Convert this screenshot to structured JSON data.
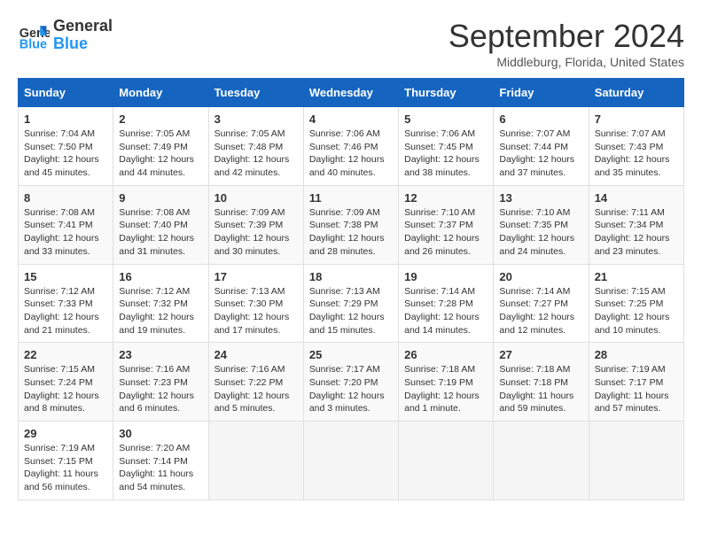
{
  "header": {
    "logo_line1": "General",
    "logo_line2": "Blue",
    "month": "September 2024",
    "location": "Middleburg, Florida, United States"
  },
  "days_of_week": [
    "Sunday",
    "Monday",
    "Tuesday",
    "Wednesday",
    "Thursday",
    "Friday",
    "Saturday"
  ],
  "weeks": [
    [
      {
        "day": "1",
        "sunrise": "7:04 AM",
        "sunset": "7:50 PM",
        "daylight": "12 hours and 45 minutes."
      },
      {
        "day": "2",
        "sunrise": "7:05 AM",
        "sunset": "7:49 PM",
        "daylight": "12 hours and 44 minutes."
      },
      {
        "day": "3",
        "sunrise": "7:05 AM",
        "sunset": "7:48 PM",
        "daylight": "12 hours and 42 minutes."
      },
      {
        "day": "4",
        "sunrise": "7:06 AM",
        "sunset": "7:46 PM",
        "daylight": "12 hours and 40 minutes."
      },
      {
        "day": "5",
        "sunrise": "7:06 AM",
        "sunset": "7:45 PM",
        "daylight": "12 hours and 38 minutes."
      },
      {
        "day": "6",
        "sunrise": "7:07 AM",
        "sunset": "7:44 PM",
        "daylight": "12 hours and 37 minutes."
      },
      {
        "day": "7",
        "sunrise": "7:07 AM",
        "sunset": "7:43 PM",
        "daylight": "12 hours and 35 minutes."
      }
    ],
    [
      {
        "day": "8",
        "sunrise": "7:08 AM",
        "sunset": "7:41 PM",
        "daylight": "12 hours and 33 minutes."
      },
      {
        "day": "9",
        "sunrise": "7:08 AM",
        "sunset": "7:40 PM",
        "daylight": "12 hours and 31 minutes."
      },
      {
        "day": "10",
        "sunrise": "7:09 AM",
        "sunset": "7:39 PM",
        "daylight": "12 hours and 30 minutes."
      },
      {
        "day": "11",
        "sunrise": "7:09 AM",
        "sunset": "7:38 PM",
        "daylight": "12 hours and 28 minutes."
      },
      {
        "day": "12",
        "sunrise": "7:10 AM",
        "sunset": "7:37 PM",
        "daylight": "12 hours and 26 minutes."
      },
      {
        "day": "13",
        "sunrise": "7:10 AM",
        "sunset": "7:35 PM",
        "daylight": "12 hours and 24 minutes."
      },
      {
        "day": "14",
        "sunrise": "7:11 AM",
        "sunset": "7:34 PM",
        "daylight": "12 hours and 23 minutes."
      }
    ],
    [
      {
        "day": "15",
        "sunrise": "7:12 AM",
        "sunset": "7:33 PM",
        "daylight": "12 hours and 21 minutes."
      },
      {
        "day": "16",
        "sunrise": "7:12 AM",
        "sunset": "7:32 PM",
        "daylight": "12 hours and 19 minutes."
      },
      {
        "day": "17",
        "sunrise": "7:13 AM",
        "sunset": "7:30 PM",
        "daylight": "12 hours and 17 minutes."
      },
      {
        "day": "18",
        "sunrise": "7:13 AM",
        "sunset": "7:29 PM",
        "daylight": "12 hours and 15 minutes."
      },
      {
        "day": "19",
        "sunrise": "7:14 AM",
        "sunset": "7:28 PM",
        "daylight": "12 hours and 14 minutes."
      },
      {
        "day": "20",
        "sunrise": "7:14 AM",
        "sunset": "7:27 PM",
        "daylight": "12 hours and 12 minutes."
      },
      {
        "day": "21",
        "sunrise": "7:15 AM",
        "sunset": "7:25 PM",
        "daylight": "12 hours and 10 minutes."
      }
    ],
    [
      {
        "day": "22",
        "sunrise": "7:15 AM",
        "sunset": "7:24 PM",
        "daylight": "12 hours and 8 minutes."
      },
      {
        "day": "23",
        "sunrise": "7:16 AM",
        "sunset": "7:23 PM",
        "daylight": "12 hours and 6 minutes."
      },
      {
        "day": "24",
        "sunrise": "7:16 AM",
        "sunset": "7:22 PM",
        "daylight": "12 hours and 5 minutes."
      },
      {
        "day": "25",
        "sunrise": "7:17 AM",
        "sunset": "7:20 PM",
        "daylight": "12 hours and 3 minutes."
      },
      {
        "day": "26",
        "sunrise": "7:18 AM",
        "sunset": "7:19 PM",
        "daylight": "12 hours and 1 minute."
      },
      {
        "day": "27",
        "sunrise": "7:18 AM",
        "sunset": "7:18 PM",
        "daylight": "11 hours and 59 minutes."
      },
      {
        "day": "28",
        "sunrise": "7:19 AM",
        "sunset": "7:17 PM",
        "daylight": "11 hours and 57 minutes."
      }
    ],
    [
      {
        "day": "29",
        "sunrise": "7:19 AM",
        "sunset": "7:15 PM",
        "daylight": "11 hours and 56 minutes."
      },
      {
        "day": "30",
        "sunrise": "7:20 AM",
        "sunset": "7:14 PM",
        "daylight": "11 hours and 54 minutes."
      },
      null,
      null,
      null,
      null,
      null
    ]
  ]
}
